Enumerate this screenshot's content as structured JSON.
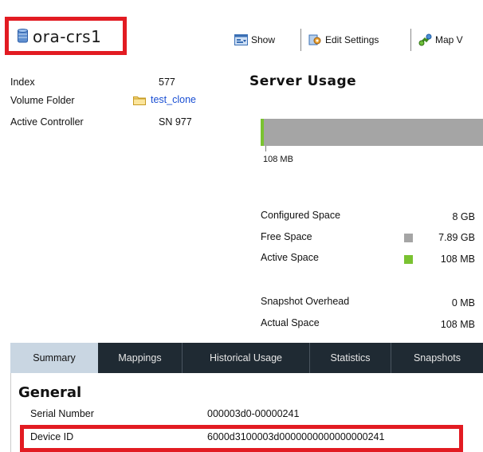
{
  "header": {
    "title": "ora-crs1"
  },
  "toolbar": {
    "show_label": "Show",
    "edit_settings_label": "Edit Settings",
    "map_label": "Map V"
  },
  "properties": {
    "index_label": "Index",
    "index_value": "577",
    "volume_folder_label": "Volume Folder",
    "volume_folder_value": "test_clone",
    "active_controller_label": "Active Controller",
    "active_controller_value": "SN 977"
  },
  "server_usage": {
    "title": "Server Usage",
    "bar_label": "108 MB",
    "active_fraction": 0.013,
    "colors": {
      "free": "#a5a5a5",
      "active": "#7ac231"
    },
    "stats": [
      {
        "label": "Configured Space",
        "value": "8 GB",
        "legend": null
      },
      {
        "label": "Free Space",
        "value": "7.89 GB",
        "legend": "free"
      },
      {
        "label": "Active Space",
        "value": "108 MB",
        "legend": "active"
      },
      {
        "label": "Snapshot Overhead",
        "value": "0 MB",
        "legend": null
      },
      {
        "label": "Actual Space",
        "value": "108 MB",
        "legend": null
      }
    ]
  },
  "tabs": [
    {
      "label": "Summary",
      "active": true
    },
    {
      "label": "Mappings",
      "active": false
    },
    {
      "label": "Historical Usage",
      "active": false
    },
    {
      "label": "Statistics",
      "active": false
    },
    {
      "label": "Snapshots",
      "active": false
    }
  ],
  "general": {
    "title": "General",
    "serial_number_label": "Serial Number",
    "serial_number_value": "000003d0-00000241",
    "device_id_label": "Device ID",
    "device_id_value": "6000d3100003d0000000000000000241"
  },
  "accent": "#e21b22"
}
